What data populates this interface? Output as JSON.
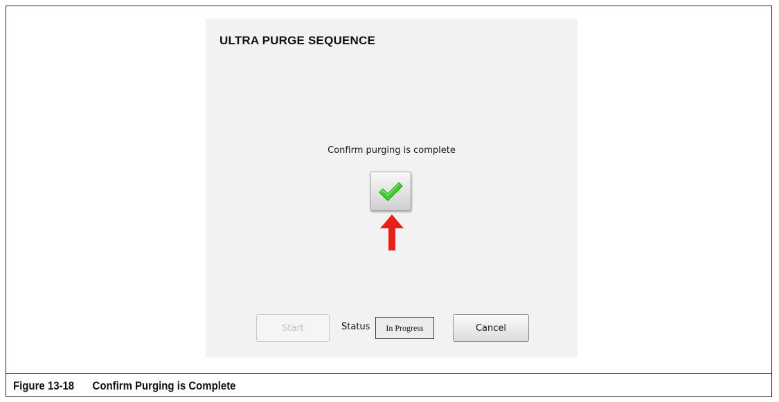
{
  "dialog": {
    "title": "ULTRA PURGE SEQUENCE",
    "prompt": "Confirm purging is complete",
    "confirm_icon": "green-checkmark-icon",
    "pointer_icon": "red-up-arrow-icon",
    "start_label": "Start",
    "status_label": "Status",
    "status_value": "In Progress",
    "cancel_label": "Cancel"
  },
  "caption": {
    "number": "Figure 13-18",
    "text": "Confirm Purging is Complete"
  },
  "colors": {
    "check": "#3ccf2d",
    "arrow": "#e8201c",
    "dialog_bg": "#f2f2f2"
  }
}
